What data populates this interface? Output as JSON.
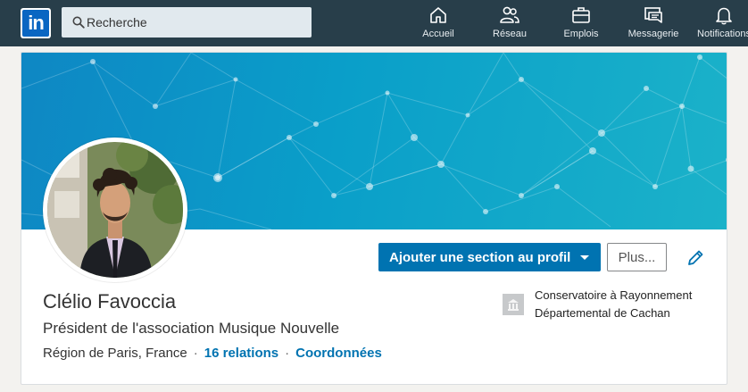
{
  "topbar": {
    "logo_text": "in",
    "search_placeholder": "Recherche",
    "nav": [
      {
        "label": "Accueil",
        "icon": "home-icon"
      },
      {
        "label": "Réseau",
        "icon": "network-icon"
      },
      {
        "label": "Emplois",
        "icon": "briefcase-icon"
      },
      {
        "label": "Messagerie",
        "icon": "messaging-icon"
      },
      {
        "label": "Notifications",
        "icon": "bell-icon"
      }
    ]
  },
  "profile": {
    "name": "Clélio Favoccia",
    "headline": "Président de l'association Musique Nouvelle",
    "location": "Région de Paris, France",
    "separator": "·",
    "relations": "16 relations",
    "contact": "Coordonnées",
    "add_section_button": "Ajouter une section au profil",
    "more_button": "Plus...",
    "organization": {
      "name_line1": "Conservatoire à Rayonnement",
      "name_line2": "Départemental de Cachan",
      "icon": "organization-icon"
    }
  },
  "colors": {
    "topbar": "#283e4a",
    "primary": "#0073b1",
    "banner_start": "#0e87c4",
    "banner_end": "#1bb2c9"
  }
}
